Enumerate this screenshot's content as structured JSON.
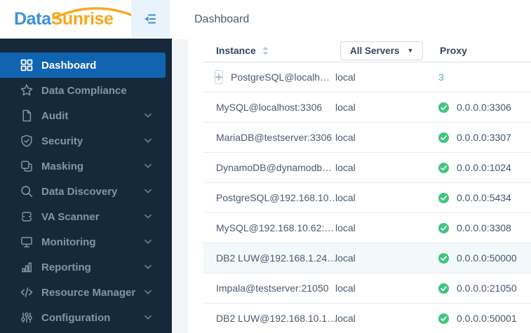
{
  "logo": {
    "part1": "Data",
    "part2": "Sunrise"
  },
  "header": {
    "title": "Dashboard"
  },
  "sidebar": {
    "items": [
      {
        "label": "Dashboard",
        "icon": "grid-icon",
        "active": true,
        "expandable": false
      },
      {
        "label": "Data Compliance",
        "icon": "star-icon",
        "active": false,
        "expandable": false
      },
      {
        "label": "Audit",
        "icon": "document-icon",
        "active": false,
        "expandable": true
      },
      {
        "label": "Security",
        "icon": "shield-icon",
        "active": false,
        "expandable": true
      },
      {
        "label": "Masking",
        "icon": "mask-icon",
        "active": false,
        "expandable": true
      },
      {
        "label": "Data Discovery",
        "icon": "search-icon",
        "active": false,
        "expandable": true
      },
      {
        "label": "VA Scanner",
        "icon": "scanner-icon",
        "active": false,
        "expandable": true
      },
      {
        "label": "Monitoring",
        "icon": "monitor-icon",
        "active": false,
        "expandable": true
      },
      {
        "label": "Reporting",
        "icon": "chart-icon",
        "active": false,
        "expandable": true
      },
      {
        "label": "Resource Manager",
        "icon": "code-icon",
        "active": false,
        "expandable": true
      },
      {
        "label": "Configuration",
        "icon": "sliders-icon",
        "active": false,
        "expandable": true
      }
    ]
  },
  "table": {
    "columns": {
      "instance": "Instance",
      "server_filter": "All Servers",
      "proxy": "Proxy"
    },
    "rows": [
      {
        "instance": "PostgreSQL@localh…",
        "server": "local",
        "proxy_count": "3",
        "expandable": true,
        "highlighted": false
      },
      {
        "instance": "MySQL@localhost:3306",
        "server": "local",
        "proxy": "0.0.0.0:3306",
        "status": "ok",
        "highlighted": false
      },
      {
        "instance": "MariaDB@testserver:3306",
        "server": "local",
        "proxy": "0.0.0.0:3307",
        "status": "ok",
        "highlighted": false
      },
      {
        "instance": "DynamoDB@dynamodb…",
        "server": "local",
        "proxy": "0.0.0.0:1024",
        "status": "ok",
        "highlighted": false
      },
      {
        "instance": "PostgreSQL@192.168.10…",
        "server": "local",
        "proxy": "0.0.0.0:5434",
        "status": "ok",
        "highlighted": false
      },
      {
        "instance": "MySQL@192.168.10.62:…",
        "server": "local",
        "proxy": "0.0.0.0:3308",
        "status": "ok",
        "highlighted": false
      },
      {
        "instance": "DB2 LUW@192.168.1.24…",
        "server": "local",
        "proxy": "0.0.0.0:50000",
        "status": "ok",
        "highlighted": true
      },
      {
        "instance": "Impala@testserver:21050",
        "server": "local",
        "proxy": "0.0.0.0:21050",
        "status": "ok",
        "highlighted": false
      },
      {
        "instance": "DB2 LUW@192.168.10.1…",
        "server": "local",
        "proxy": "0.0.0.0:50001",
        "status": "ok",
        "highlighted": false
      }
    ]
  },
  "colors": {
    "sidebar_bg": "#16293a",
    "active_item_bg": "#1064b0",
    "sidebar_text": "#8296a9",
    "logo_blue": "#3e90d9",
    "logo_orange": "#f8a81e",
    "status_green": "#3ec57f",
    "link_green": "#45bd85",
    "content_bg": "#f3f6f8",
    "collapse_btn_bg": "#e9f3fc"
  }
}
